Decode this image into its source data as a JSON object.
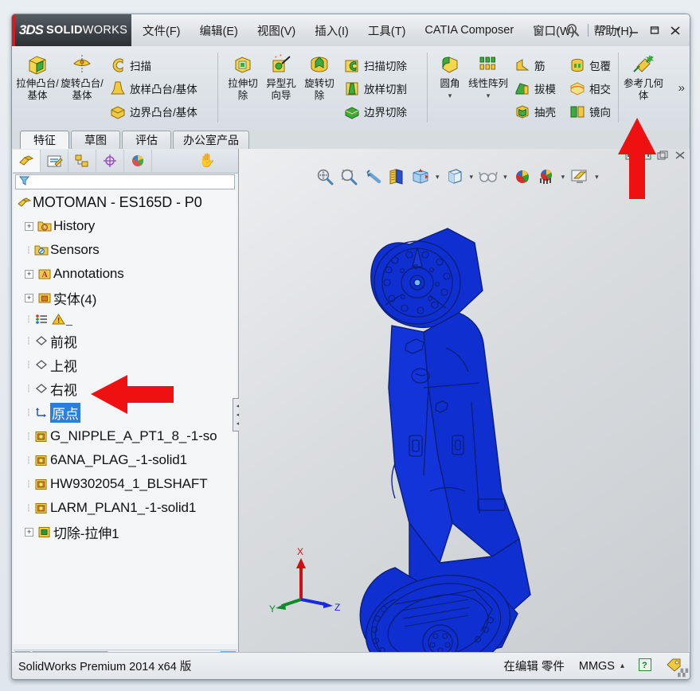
{
  "window": {
    "brand_ds": "3DS",
    "brand_name_bold": "SOLID",
    "brand_name_light": "WORKS",
    "controls": [
      "help-question",
      "dropdown-caret",
      "minimize",
      "restore",
      "close"
    ]
  },
  "menu": {
    "items": [
      {
        "label": "文件(F)",
        "name": "menu-file"
      },
      {
        "label": "编辑(E)",
        "name": "menu-edit"
      },
      {
        "label": "视图(V)",
        "name": "menu-view"
      },
      {
        "label": "插入(I)",
        "name": "menu-insert"
      },
      {
        "label": "工具(T)",
        "name": "menu-tools"
      },
      {
        "label": "CATIA Composer",
        "name": "menu-catia-composer"
      },
      {
        "label": "窗口(W)",
        "name": "menu-window"
      },
      {
        "label": "帮助(H)",
        "name": "menu-help"
      }
    ]
  },
  "ribbon": {
    "overflow_label": "»",
    "groups": [
      {
        "name": "boss-base-group",
        "big": [
          {
            "label": "拉伸凸台/基体",
            "icon": "extruded-boss-icon",
            "name": "extruded-boss-button"
          },
          {
            "label": "旋转凸台/基体",
            "icon": "revolved-boss-icon",
            "name": "revolved-boss-button"
          }
        ],
        "small": [
          {
            "label": "扫描",
            "icon": "swept-boss-icon",
            "name": "swept-boss-button"
          },
          {
            "label": "放样凸台/基体",
            "icon": "lofted-boss-icon",
            "name": "lofted-boss-button"
          },
          {
            "label": "边界凸台/基体",
            "icon": "boundary-boss-icon",
            "name": "boundary-boss-button"
          }
        ]
      },
      {
        "name": "cut-group",
        "big": [
          {
            "label": "拉伸切除",
            "icon": "extruded-cut-icon",
            "name": "extruded-cut-button"
          },
          {
            "label": "异型孔向导",
            "icon": "hole-wizard-icon",
            "name": "hole-wizard-button"
          },
          {
            "label": "旋转切除",
            "icon": "revolved-cut-icon",
            "name": "revolved-cut-button"
          }
        ],
        "small": [
          {
            "label": "扫描切除",
            "icon": "swept-cut-icon",
            "name": "swept-cut-button"
          },
          {
            "label": "放样切割",
            "icon": "lofted-cut-icon",
            "name": "lofted-cut-button"
          },
          {
            "label": "边界切除",
            "icon": "boundary-cut-icon",
            "name": "boundary-cut-button"
          }
        ]
      },
      {
        "name": "feature-group",
        "big": [
          {
            "label": "圆角",
            "icon": "fillet-icon",
            "name": "fillet-button",
            "caret": "▾"
          },
          {
            "label": "线性阵列",
            "icon": "linear-pattern-icon",
            "name": "linear-pattern-button",
            "caret": "▾"
          }
        ],
        "small": [
          {
            "label": "筋",
            "icon": "rib-icon",
            "name": "rib-button"
          },
          {
            "label": "拔模",
            "icon": "draft-icon",
            "name": "draft-button"
          },
          {
            "label": "抽壳",
            "icon": "shell-icon",
            "name": "shell-button"
          },
          {
            "label": "包覆",
            "icon": "wrap-icon",
            "name": "wrap-button"
          },
          {
            "label": "相交",
            "icon": "intersect-icon",
            "name": "intersect-button"
          },
          {
            "label": "镜向",
            "icon": "mirror-icon",
            "name": "mirror-button"
          }
        ]
      },
      {
        "name": "reference-group",
        "big": [
          {
            "label": "参考几何体",
            "icon": "reference-geometry-icon",
            "name": "reference-geometry-button"
          }
        ],
        "small": []
      }
    ]
  },
  "command_tabs": [
    {
      "label": "特征",
      "name": "tab-features",
      "active": true
    },
    {
      "label": "草图",
      "name": "tab-sketch",
      "active": false
    },
    {
      "label": "评估",
      "name": "tab-evaluate",
      "active": false
    },
    {
      "label": "办公室产品",
      "name": "tab-office-products",
      "active": false
    }
  ],
  "panel_tabs": [
    {
      "name": "tab-feature-manager",
      "icon": "feature-tree-icon",
      "selected": true
    },
    {
      "name": "tab-property-manager",
      "icon": "property-manager-icon",
      "selected": false
    },
    {
      "name": "tab-configuration-manager",
      "icon": "configuration-manager-icon",
      "selected": false
    },
    {
      "name": "tab-dimxpert-manager",
      "icon": "dimxpert-icon",
      "selected": false
    },
    {
      "name": "tab-display-manager",
      "icon": "display-manager-icon",
      "selected": false
    }
  ],
  "tree": {
    "filter_placeholder": "",
    "root": {
      "label": "MOTOMAN - ES165D - P0",
      "icon": "part-icon"
    },
    "items": [
      {
        "label": "History",
        "icon": "history-folder-icon",
        "expander": "+",
        "name": "tree-item-history"
      },
      {
        "label": "Sensors",
        "icon": "sensors-folder-icon",
        "expander": "",
        "name": "tree-item-sensors"
      },
      {
        "label": "Annotations",
        "icon": "annotations-folder-icon",
        "expander": "+",
        "name": "tree-item-annotations"
      },
      {
        "label": "实体(4)",
        "icon": "solid-bodies-icon",
        "expander": "+",
        "name": "tree-item-solid-bodies"
      },
      {
        "label": "_",
        "icon": "material-warning-icon",
        "expander": "",
        "name": "tree-item-material"
      },
      {
        "label": "前视",
        "icon": "plane-icon",
        "expander": "",
        "name": "tree-item-front-plane"
      },
      {
        "label": "上视",
        "icon": "plane-icon",
        "expander": "",
        "name": "tree-item-top-plane"
      },
      {
        "label": "右视",
        "icon": "plane-icon",
        "expander": "",
        "name": "tree-item-right-plane"
      },
      {
        "label": "原点",
        "icon": "origin-icon",
        "expander": "",
        "name": "tree-item-origin",
        "selected": true
      },
      {
        "label": "G_NIPPLE_A_PT1_8_-1-so",
        "icon": "imported-body-icon",
        "expander": "",
        "name": "tree-item-g-nipple"
      },
      {
        "label": "6ANA_PLAG_-1-solid1",
        "icon": "imported-body-icon",
        "expander": "",
        "name": "tree-item-6ana-plag"
      },
      {
        "label": "HW9302054_1_BLSHAFT",
        "icon": "imported-body-icon",
        "expander": "",
        "name": "tree-item-hw9302054"
      },
      {
        "label": "LARM_PLAN1_-1-solid1",
        "icon": "imported-body-icon",
        "expander": "",
        "name": "tree-item-larm-plan1"
      },
      {
        "label": "切除-拉伸1",
        "icon": "cut-extrude-icon",
        "expander": "+",
        "name": "tree-item-cut-extrude1"
      }
    ],
    "scrollbar": {
      "left_arrow": "◀",
      "right_arrow": "▶",
      "thumb_grip": "|||"
    }
  },
  "graphics": {
    "corner_buttons": [
      "restore-view-icon",
      "expand-view-icon",
      "window-view-icon",
      "close-view-icon"
    ],
    "view_toolbar": [
      {
        "name": "zoom-to-fit-icon",
        "caret": ""
      },
      {
        "name": "zoom-to-area-icon",
        "caret": ""
      },
      {
        "name": "previous-view-icon",
        "caret": ""
      },
      {
        "name": "section-view-icon",
        "caret": ""
      },
      {
        "name": "view-orientation-icon",
        "caret": "▾"
      },
      {
        "name": "display-style-icon",
        "caret": "▾"
      },
      {
        "name": "hide-show-items-icon",
        "caret": "▾"
      },
      {
        "name": "edit-appearance-icon",
        "caret": ""
      },
      {
        "name": "apply-scene-icon",
        "caret": "▾"
      },
      {
        "name": "view-settings-icon",
        "caret": "▾"
      }
    ],
    "triad": {
      "x": "X",
      "y": "Y",
      "z": "Z"
    },
    "model_color": "#0f2fd0",
    "model_edge_color": "#0a1f7a",
    "background_colors": [
      "#eceef0",
      "#c8ccd0"
    ]
  },
  "statusbar": {
    "left": "SolidWorks Premium 2014 x64 版",
    "editing": "在编辑 零件",
    "units": "MMGS",
    "units_caret": "▴",
    "help_badge": "?",
    "tag_icon": "tag-icon"
  },
  "annotations": {
    "arrow_color": "#ef1111",
    "arrows": [
      {
        "name": "red-arrow-reference-geometry",
        "direction": "up"
      },
      {
        "name": "red-arrow-origin",
        "direction": "left"
      }
    ]
  }
}
